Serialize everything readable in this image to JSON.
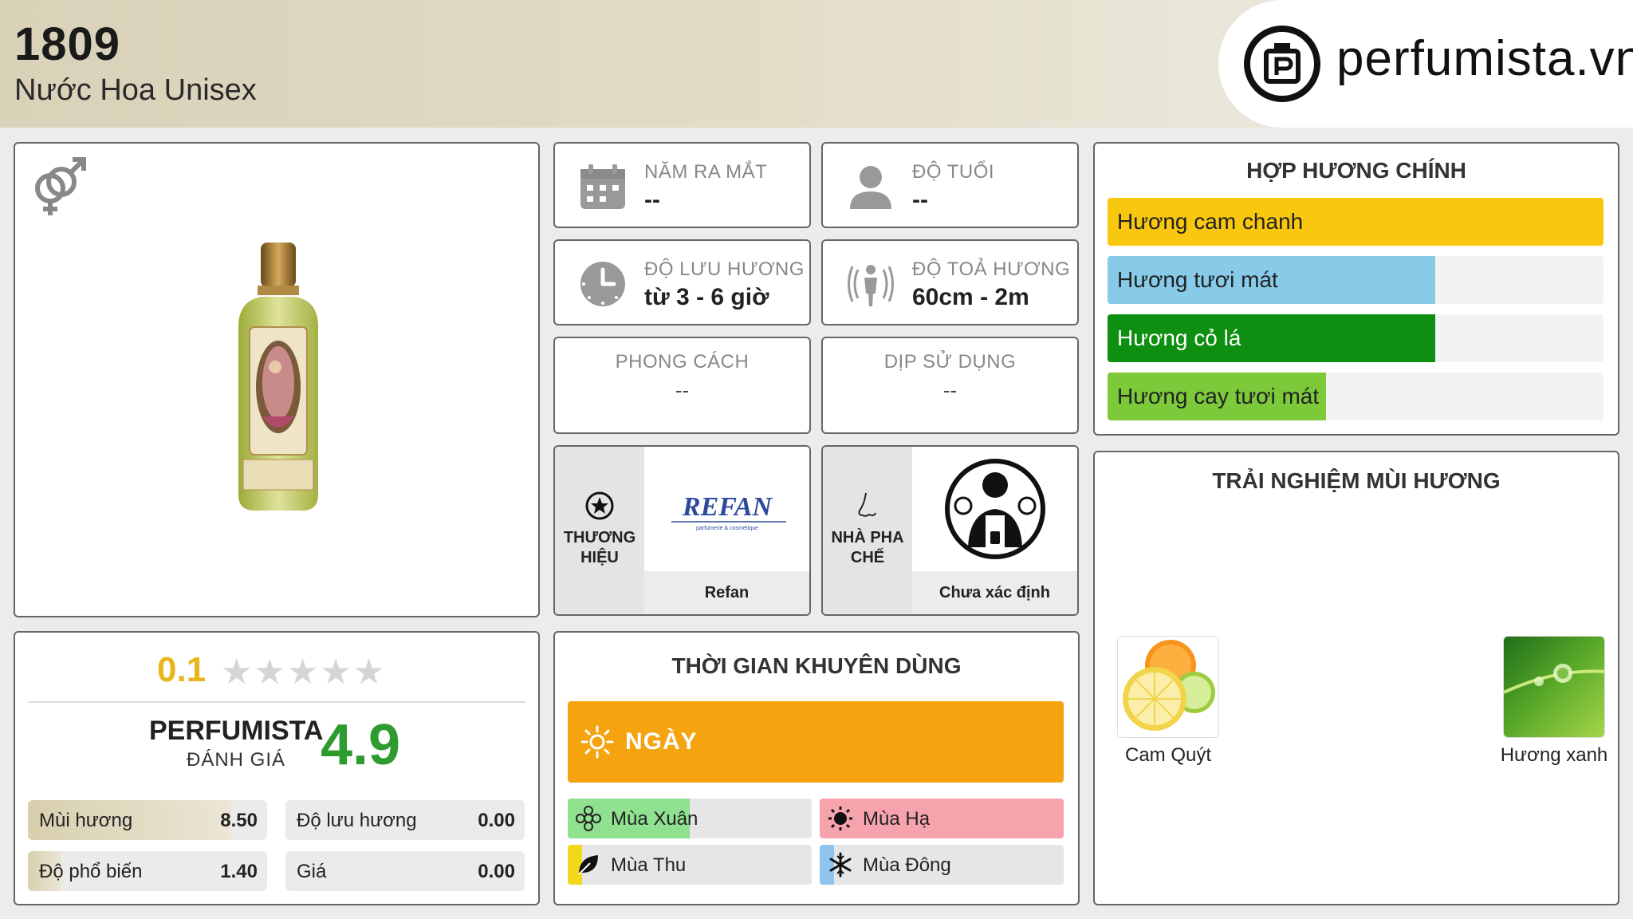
{
  "header": {
    "title": "1809",
    "subtitle": "Nước Hoa Unisex",
    "logo_text": "perfumista.vn"
  },
  "product": {
    "gender_icon": "unisex-icon",
    "image": "perfume-bottle"
  },
  "info": {
    "release_year": {
      "label": "NĂM RA MẮT",
      "value": "--",
      "icon": "calendar-icon"
    },
    "age": {
      "label": "ĐỘ TUỔI",
      "value": "--",
      "icon": "user-icon"
    },
    "longevity": {
      "label": "ĐỘ LƯU HƯƠNG",
      "value": "từ 3 - 6 giờ",
      "icon": "clock-icon"
    },
    "sillage": {
      "label": "ĐỘ TOẢ HƯƠNG",
      "value": "60cm - 2m",
      "icon": "sillage-icon"
    },
    "style": {
      "label": "PHONG CÁCH",
      "value": "--"
    },
    "occasion": {
      "label": "DỊP SỬ DỤNG",
      "value": "--"
    },
    "brand": {
      "label_line1": "THƯƠNG",
      "label_line2": "HIỆU",
      "name": "Refan",
      "logo_text": "REFAN",
      "logo_sub": "parfumerie & cosmétique"
    },
    "perfumer": {
      "label_line1": "NHÀ PHA",
      "label_line2": "CHẾ",
      "name": "Chưa xác định"
    }
  },
  "notes": {
    "title": "HỢP HƯƠNG CHÍNH",
    "items": [
      {
        "label": "Hương cam chanh",
        "level": 1.0,
        "color": "#f9c80e"
      },
      {
        "label": "Hương tươi mát",
        "level": 0.66,
        "color": "#87cbe8"
      },
      {
        "label": "Hương cỏ lá",
        "level": 0.66,
        "color": "#0e8f12"
      },
      {
        "label": "Hương cay tươi mát",
        "level": 0.44,
        "color": "#7cc93a"
      }
    ]
  },
  "rating": {
    "user_score": "0.1",
    "stars_filled": 0.02,
    "perfumista_label": "PERFUMISTA",
    "perfumista_sub": "ĐÁNH GIÁ",
    "perfumista_score": "4.9",
    "metrics": [
      {
        "label": "Mùi hương",
        "value": "8.50",
        "fill": 0.85
      },
      {
        "label": "Độ lưu hương",
        "value": "0.00",
        "fill": 0.0
      },
      {
        "label": "Độ phổ biến",
        "value": "1.40",
        "fill": 0.14
      },
      {
        "label": "Giá",
        "value": "0.00",
        "fill": 0.0
      }
    ]
  },
  "time": {
    "title": "THỜI GIAN KHUYÊN DÙNG",
    "day_label": "NGÀY",
    "day_color": "#f5a30f",
    "seasons": [
      {
        "label": "Mùa Xuân",
        "fill": 0.5,
        "color": "#8fe08f",
        "icon": "flower-icon"
      },
      {
        "label": "Mùa Hạ",
        "fill": 1.0,
        "color": "#f7a3ad",
        "icon": "sun-icon"
      },
      {
        "label": "Mùa Thu",
        "fill": 0.06,
        "color": "#f2d81a",
        "icon": "leaf-icon"
      },
      {
        "label": "Mùa Đông",
        "fill": 0.06,
        "color": "#8fc4ee",
        "icon": "snowflake-icon"
      }
    ]
  },
  "experience": {
    "title": "TRẢI NGHIỆM MÙI HƯƠNG",
    "items": [
      {
        "label": "Cam Quýt",
        "image": "citrus-image"
      },
      {
        "label": "Hương xanh",
        "image": "green-leaf-image"
      }
    ]
  }
}
